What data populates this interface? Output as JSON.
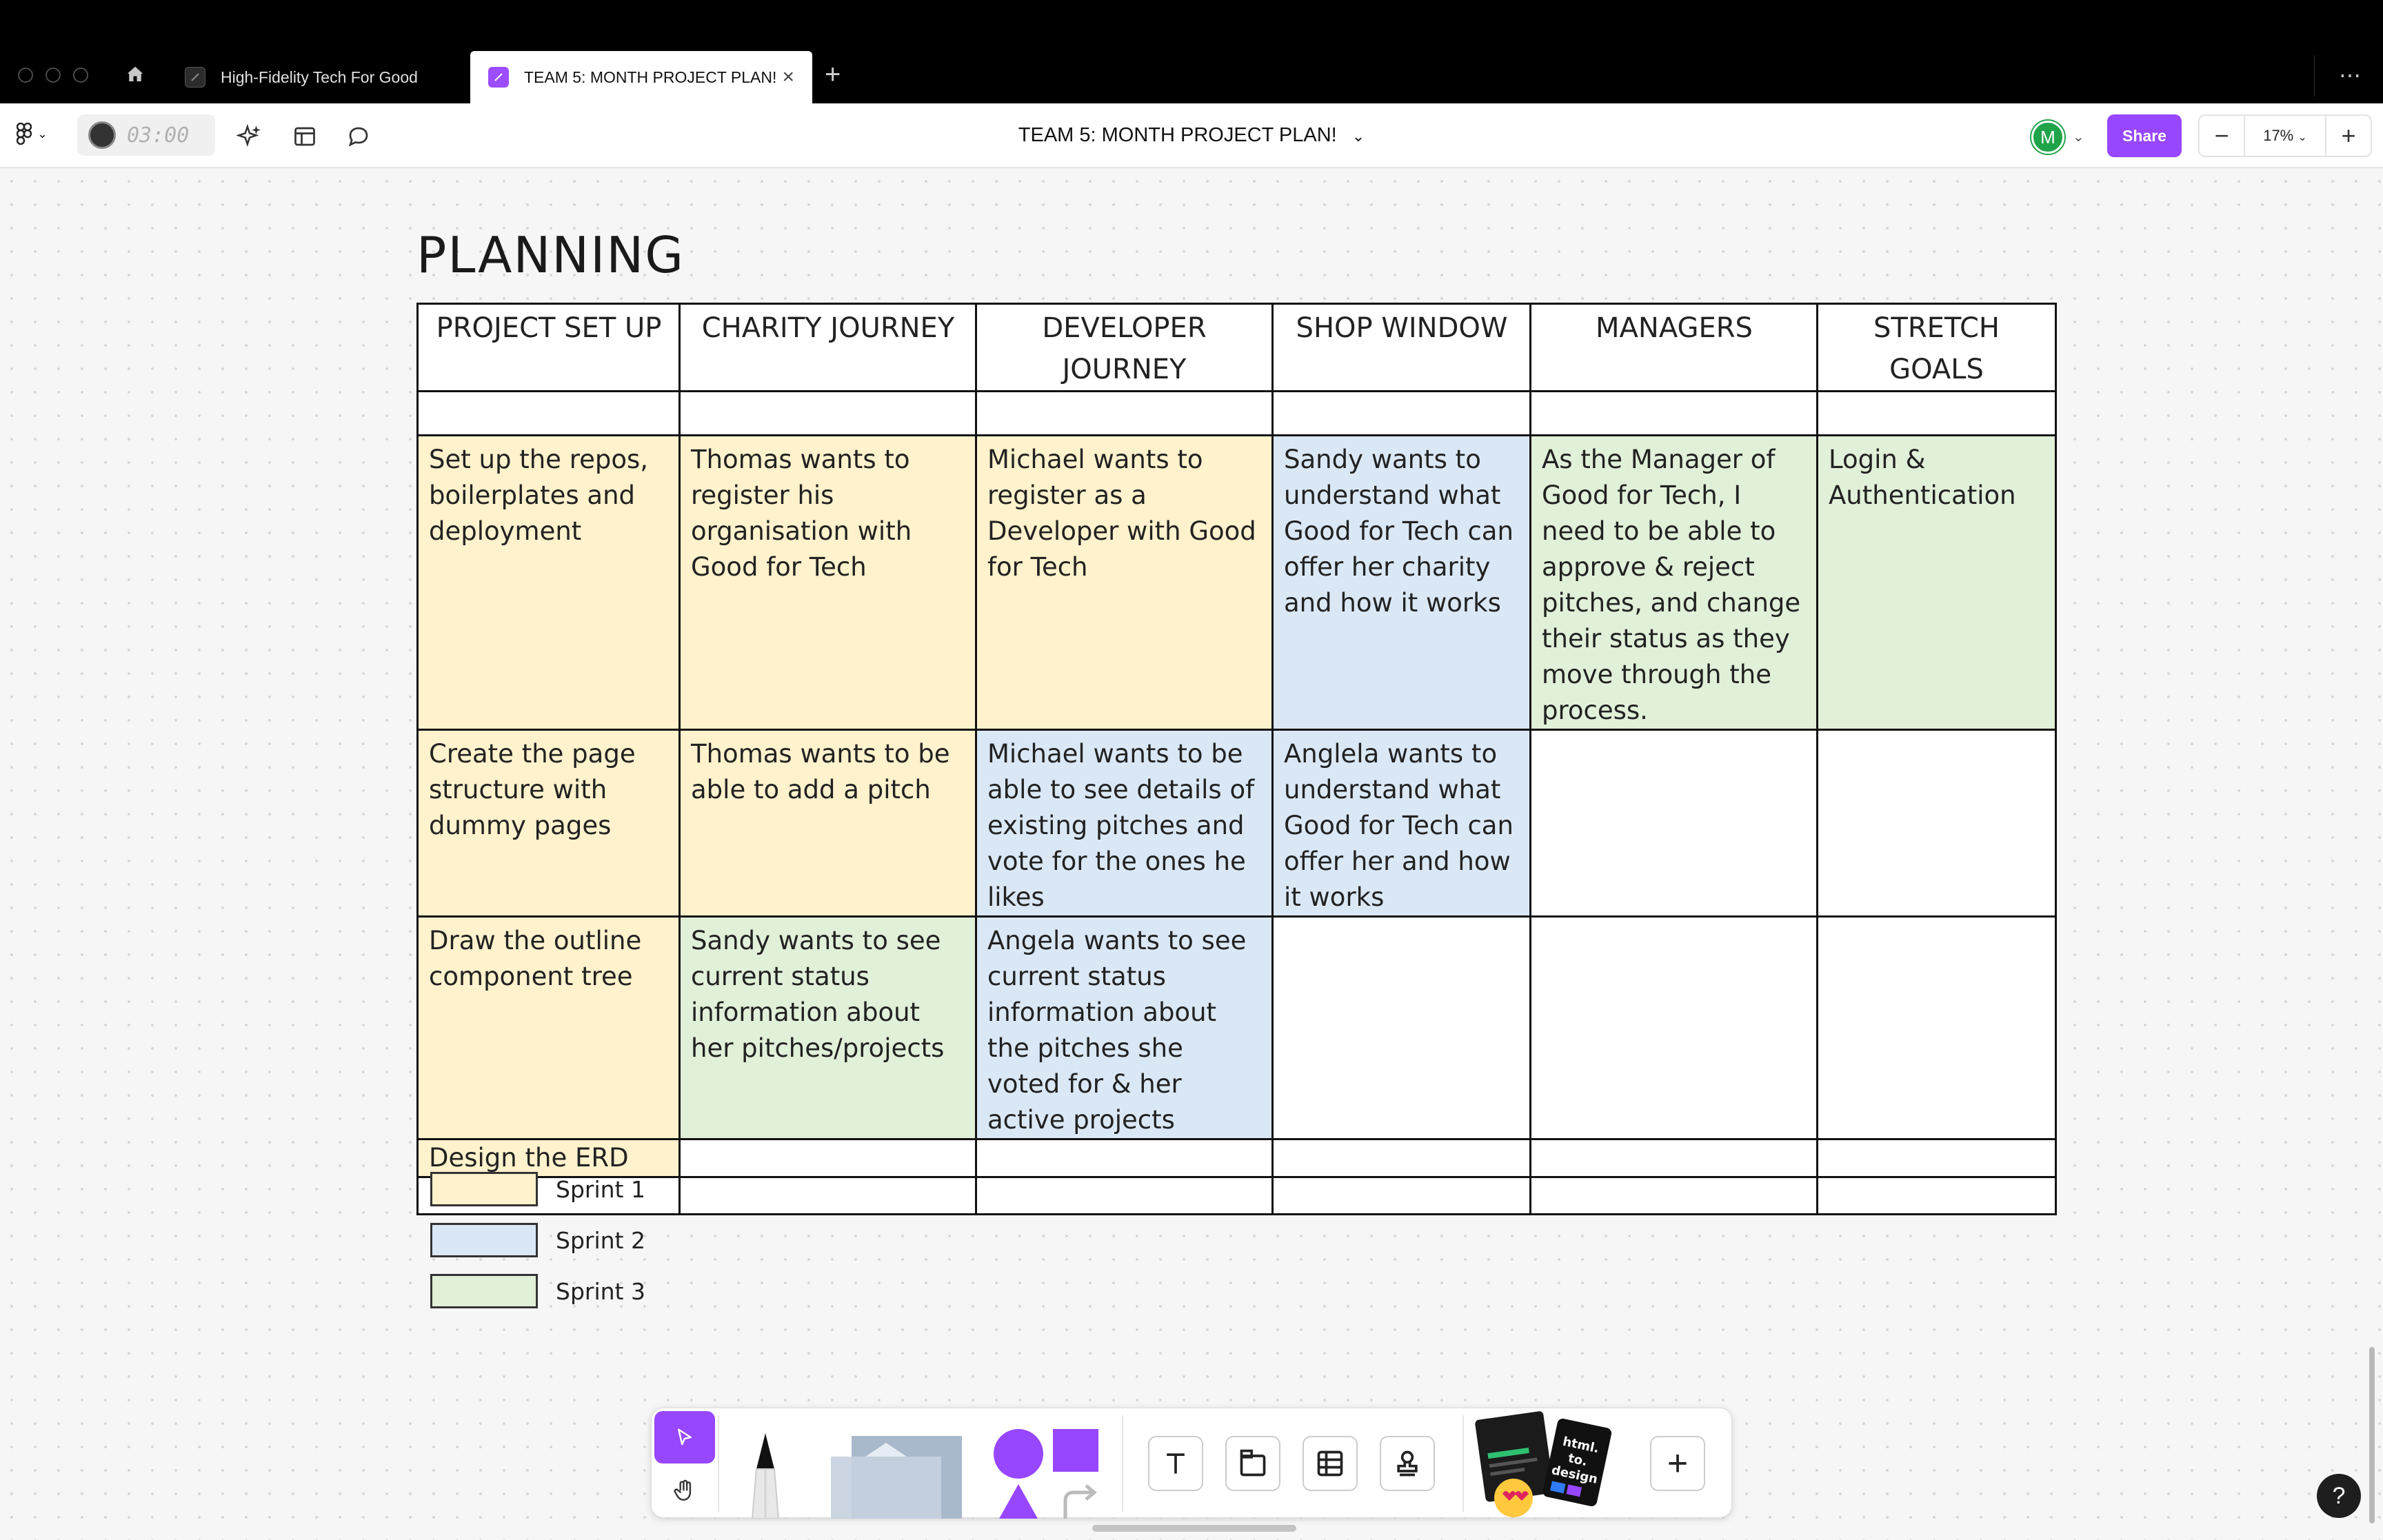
{
  "browser": {
    "tabs": [
      {
        "title": "High-Fidelity Tech For Good",
        "active": false
      },
      {
        "title": "TEAM 5: MONTH PROJECT PLAN!",
        "active": true
      }
    ],
    "close_glyph": "×",
    "new_tab_glyph": "+",
    "more_glyph": "⋯"
  },
  "toolbar": {
    "timer": "03:00",
    "document_title": "TEAM 5: MONTH PROJECT PLAN!",
    "title_chevron": "⌄",
    "avatar_initial": "M",
    "share_label": "Share",
    "zoom_out": "−",
    "zoom_level": "17%",
    "zoom_in": "+",
    "icons": [
      "figma-menu-icon",
      "ai-sparkle-icon",
      "layout-icon",
      "comment-icon"
    ]
  },
  "board": {
    "title": "PLANNING",
    "columns": [
      "PROJECT SET UP",
      "CHARITY JOURNEY",
      "DEVELOPER JOURNEY",
      "SHOP WINDOW",
      "MANAGERS",
      "STRETCH GOALS"
    ],
    "rows": [
      [
        {
          "text": "Set up the repos, boilerplates and deployment",
          "sprint": 1
        },
        {
          "text": "Thomas wants to register his organisation with Good for Tech",
          "sprint": 1
        },
        {
          "text": "Michael wants to register as a Developer with Good for Tech",
          "sprint": 1
        },
        {
          "text": "Sandy wants to understand what Good for Tech can offer her charity and how it works",
          "sprint": 2
        },
        {
          "text": "As the Manager of Good for Tech, I need to be able to approve & reject pitches, and change their status as they move through the process.",
          "sprint": 3
        },
        {
          "text": "Login & Authentication",
          "sprint": 3
        }
      ],
      [
        {
          "text": "Create the page structure with dummy pages",
          "sprint": 1
        },
        {
          "text": "Thomas wants to be able to add a pitch",
          "sprint": 1
        },
        {
          "text": "Michael wants to be able to see details of existing pitches and vote for the ones he likes",
          "sprint": 2
        },
        {
          "text": "Anglela wants to understand what Good for Tech can offer her and how it works",
          "sprint": 2
        },
        {
          "text": "",
          "sprint": 0
        },
        {
          "text": "",
          "sprint": 0
        }
      ],
      [
        {
          "text": "Draw the outline component tree",
          "sprint": 1
        },
        {
          "text": "Sandy wants to see current status information about her pitches/projects",
          "sprint": 3
        },
        {
          "text": "Angela wants to see current status information about the pitches she voted for & her active projects",
          "sprint": 2
        },
        {
          "text": "",
          "sprint": 0
        },
        {
          "text": "",
          "sprint": 0
        },
        {
          "text": "",
          "sprint": 0
        }
      ],
      [
        {
          "text": "Design the ERD",
          "sprint": 1
        },
        {
          "text": "",
          "sprint": 0
        },
        {
          "text": "",
          "sprint": 0
        },
        {
          "text": "",
          "sprint": 0
        },
        {
          "text": "",
          "sprint": 0
        },
        {
          "text": "",
          "sprint": 0
        }
      ]
    ],
    "legend": [
      {
        "label": "Sprint 1",
        "color": "#fff2cc"
      },
      {
        "label": "Sprint 2",
        "color": "#dae8f6"
      },
      {
        "label": "Sprint 3",
        "color": "#e1f0d8"
      }
    ]
  },
  "dock": {
    "tools": [
      "move-tool",
      "hand-tool",
      "pen-tool",
      "sticky-note-tool",
      "shapes-tool",
      "text-tool",
      "section-tool",
      "table-tool",
      "stamp-tool",
      "widgets-tool",
      "add-more-tool"
    ],
    "widget_card_text": "html. to. design",
    "plus_glyph": "+"
  },
  "help_glyph": "?",
  "colors": {
    "accent": "#9747ff",
    "avatar": "#1fa44a",
    "sprint1": "#fff2cc",
    "sprint2": "#dae8f6",
    "sprint3": "#e1f0d8"
  }
}
